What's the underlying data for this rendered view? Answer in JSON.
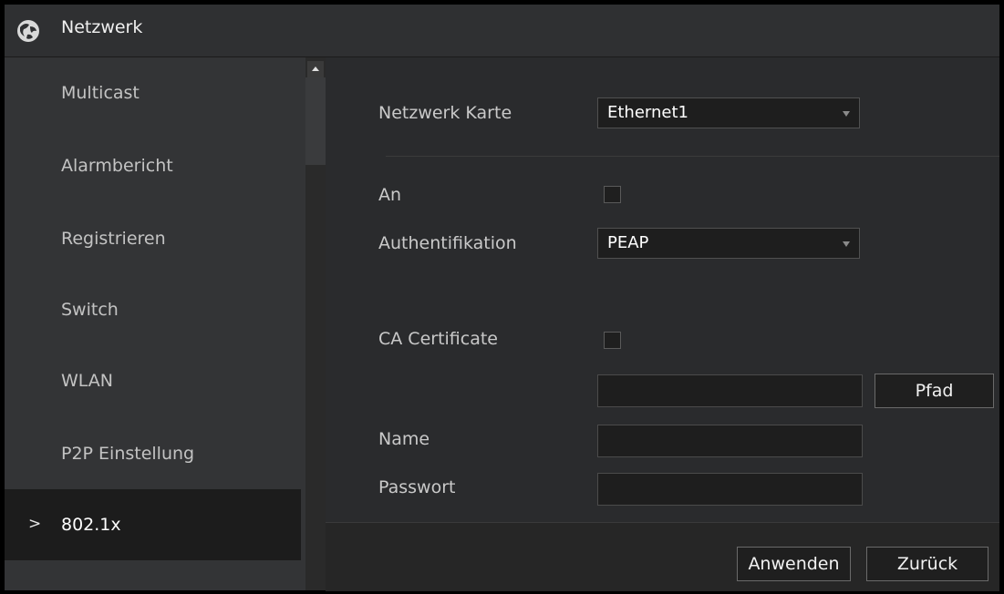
{
  "window": {
    "title": "Netzwerk",
    "logo_icon": "dahua-globe-icon"
  },
  "sidebar": {
    "items": [
      {
        "label": "Multicast",
        "active": false
      },
      {
        "label": "Alarmbericht",
        "active": false
      },
      {
        "label": "Registrieren",
        "active": false
      },
      {
        "label": "Switch",
        "active": false
      },
      {
        "label": "WLAN",
        "active": false
      },
      {
        "label": "P2P Einstellung",
        "active": false
      },
      {
        "label": "802.1x",
        "active": true,
        "chevron": ">"
      }
    ]
  },
  "form": {
    "network_card_label": "Netzwerk Karte",
    "network_card_value": "Ethernet1",
    "enable_label": "An",
    "enable_checked": false,
    "auth_label": "Authentifikation",
    "auth_value": "PEAP",
    "ca_label": "CA Certificate",
    "ca_checked": false,
    "path_value": "",
    "path_button": "Pfad",
    "name_label": "Name",
    "name_value": "",
    "password_label": "Passwort",
    "password_value": ""
  },
  "footer": {
    "apply_button": "Anwenden",
    "back_button": "Zurück"
  },
  "colors": {
    "background": "#262626",
    "sidebar": "#333436",
    "active_item": "#1c1c1c",
    "input": "#1e1e1e",
    "text": "#c9c9c9"
  }
}
